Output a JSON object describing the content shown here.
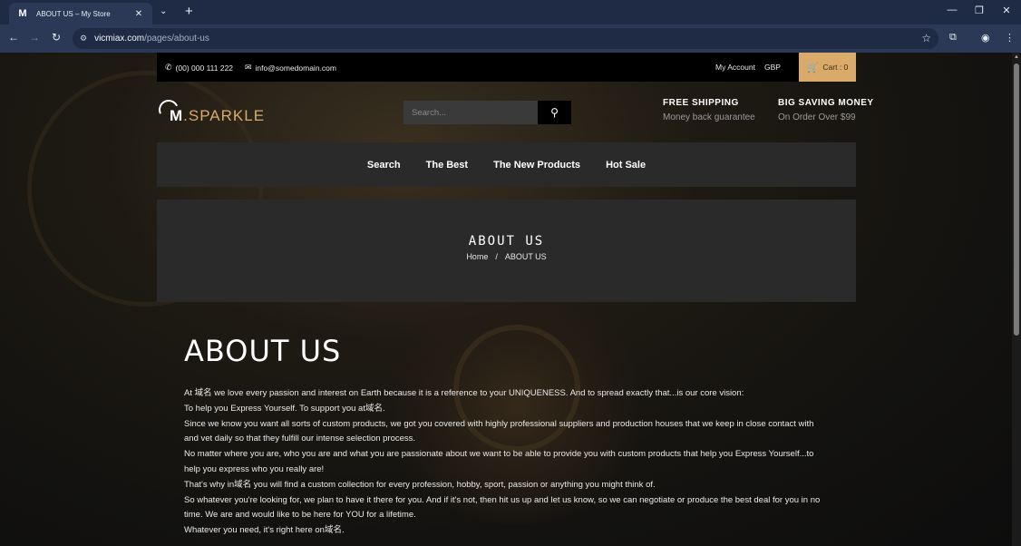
{
  "browser": {
    "tab_title": "ABOUT US – My Store",
    "favicon": "M",
    "url_host": "vicmiax.com",
    "url_path": "/pages/about-us"
  },
  "topbar": {
    "phone": "(00) 000 111 222",
    "email": "info@somedomain.com",
    "my_account": "My Account",
    "currency": "GBP",
    "cart": "Cart : 0"
  },
  "logo": {
    "m": "M",
    "rest": ".SPARKLE"
  },
  "search": {
    "placeholder": "Search..."
  },
  "promos": [
    {
      "head": "FREE SHIPPING",
      "sub": "Money back guarantee"
    },
    {
      "head": "BIG SAVING MONEY",
      "sub": "On Order Over $99"
    }
  ],
  "nav": [
    "Search",
    "The Best",
    "The New Products",
    "Hot Sale"
  ],
  "hero": {
    "title": "ABOUT US",
    "home": "Home",
    "separator": "/",
    "current": "ABOUT US"
  },
  "content": {
    "heading": "ABOUT US",
    "lines": [
      "At 域名 we love every passion and interest on Earth because it is a reference to your UNIQUENESS. And to spread exactly that...is our core vision:",
      "To help you Express Yourself. To support you at域名.",
      "Since we know you want all sorts of custom products, we got you covered with highly professional suppliers and production houses that we keep in close contact with and vet daily so that they fulfill our intense selection process.",
      "No matter where you are, who you are and what you are passionate about we want to be able to provide you with custom products that help you Express Yourself...to help you express who you really are!",
      "That's why in域名 you will find a custom collection for every profession, hobby, sport, passion or anything you might think of.",
      "So whatever you're looking for, we plan to have it there for you. And if it's not, then hit us up and let us know, so we can negotiate or produce the best deal for you in no time. We are and would like to be here for YOU for a lifetime.",
      "Whatever you need, it's right here on域名."
    ]
  }
}
